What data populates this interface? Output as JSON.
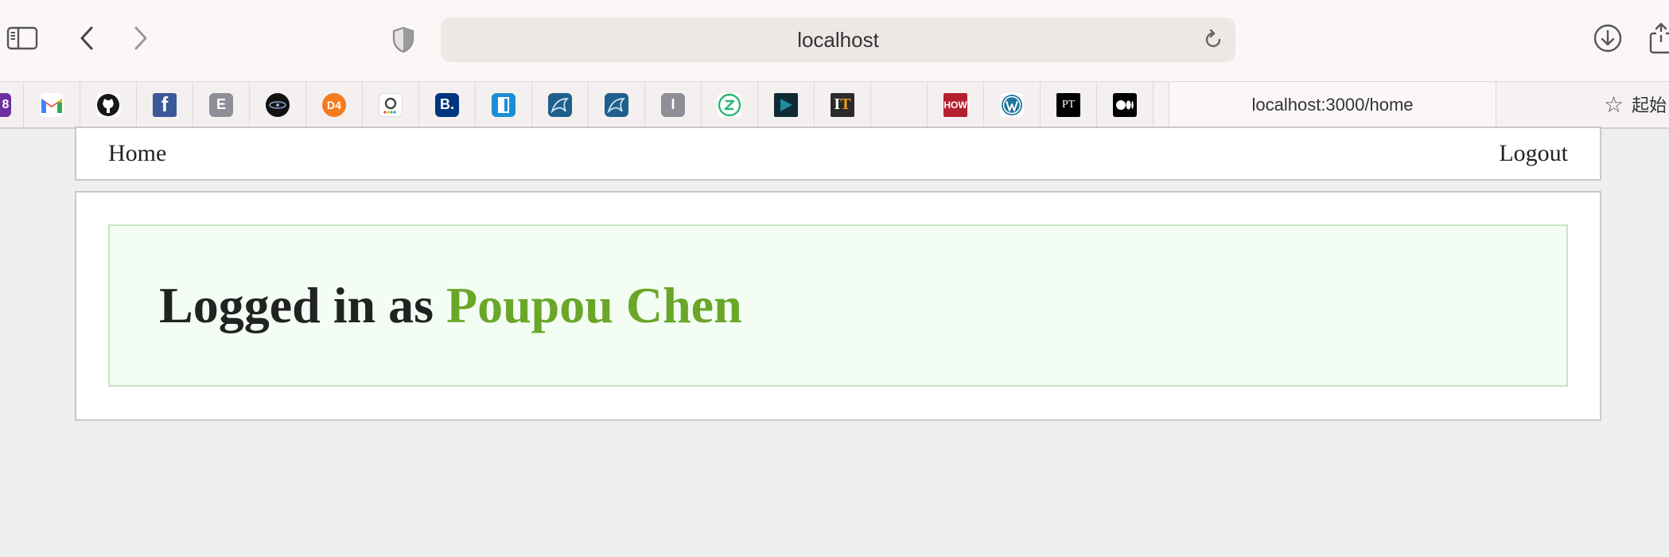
{
  "browser": {
    "address_bar": "localhost",
    "active_tab_title": "localhost:3000/home",
    "overflow_tab_label": "起始",
    "bookmarks": [
      {
        "name": "partial-purple",
        "glyph": "8",
        "color": "#6b2fa0"
      },
      {
        "name": "gmail",
        "glyph": "M",
        "color": "#ea4335"
      },
      {
        "name": "github",
        "glyph": "",
        "color": "#181717"
      },
      {
        "name": "facebook",
        "glyph": "f",
        "color": "#3b5998"
      },
      {
        "name": "e-site",
        "glyph": "E",
        "color": "#8e8e96"
      },
      {
        "name": "dark-logo",
        "glyph": "",
        "color": "#111111"
      },
      {
        "name": "d4",
        "glyph": "D4",
        "color": "#f47c20"
      },
      {
        "name": "a-site",
        "glyph": "a",
        "color": "#ffffff"
      },
      {
        "name": "booking",
        "glyph": "B.",
        "color": "#003580"
      },
      {
        "name": "door-app",
        "glyph": "",
        "color": "#1a8fd6"
      },
      {
        "name": "mysql-1",
        "glyph": "",
        "color": "#1f5f8b"
      },
      {
        "name": "mysql-2",
        "glyph": "",
        "color": "#1f5f8b"
      },
      {
        "name": "i-site",
        "glyph": "I",
        "color": "#8e8e96"
      },
      {
        "name": "z-site",
        "glyph": "Z",
        "color": "#2bb673"
      },
      {
        "name": "play-dark",
        "glyph": "",
        "color": "#0f2a33"
      },
      {
        "name": "it-site",
        "glyph": "IT",
        "color": "#2b2b2b"
      },
      {
        "name": "blank",
        "glyph": "",
        "color": "#f3f0ef"
      },
      {
        "name": "how",
        "glyph": "HOW",
        "color": "#b5202e"
      },
      {
        "name": "wordpress",
        "glyph": "W",
        "color": "#21759b"
      },
      {
        "name": "pt-site",
        "glyph": "PT",
        "color": "#000000"
      },
      {
        "name": "medium",
        "glyph": "●●",
        "color": "#000000"
      }
    ]
  },
  "nav": {
    "home_label": "Home",
    "logout_label": "Logout"
  },
  "main": {
    "welcome_prefix": "Logged in as",
    "username": "Poupou Chen"
  },
  "colors": {
    "accent_username": "#6aa628",
    "alert_background": "#f3fdf3",
    "alert_border": "#c6e6c6",
    "page_background": "#efefef"
  }
}
